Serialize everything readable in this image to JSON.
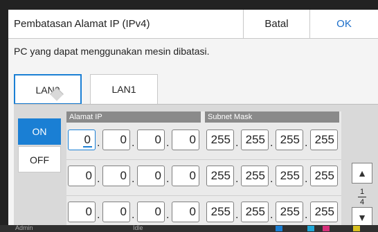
{
  "dialog": {
    "title": "Pembatasan Alamat IP (IPv4)",
    "cancel_label": "Batal",
    "ok_label": "OK",
    "description": "PC yang dapat menggunakan mesin dibatasi."
  },
  "tabs": [
    "LAN0",
    "LAN1"
  ],
  "toggle": {
    "on_label": "ON",
    "off_label": "OFF",
    "selected": "ON"
  },
  "headers": {
    "ip": "Alamat IP",
    "mask": "Subnet Mask"
  },
  "rows": [
    {
      "ip": [
        "0",
        "0",
        "0",
        "0"
      ],
      "mask": [
        "255",
        "255",
        "255",
        "255"
      ]
    },
    {
      "ip": [
        "0",
        "0",
        "0",
        "0"
      ],
      "mask": [
        "255",
        "255",
        "255",
        "255"
      ]
    },
    {
      "ip": [
        "0",
        "0",
        "0",
        "0"
      ],
      "mask": [
        "255",
        "255",
        "255",
        "255"
      ]
    }
  ],
  "separator": ".",
  "page": {
    "current": "1",
    "total": "4"
  },
  "status": {
    "user": "Admin",
    "state": "Idle"
  },
  "icons": {
    "up": "triangle-up-icon",
    "down": "triangle-down-icon"
  },
  "colors": {
    "accent": "#1a7fd4",
    "ok_text": "#1a6dc9"
  }
}
